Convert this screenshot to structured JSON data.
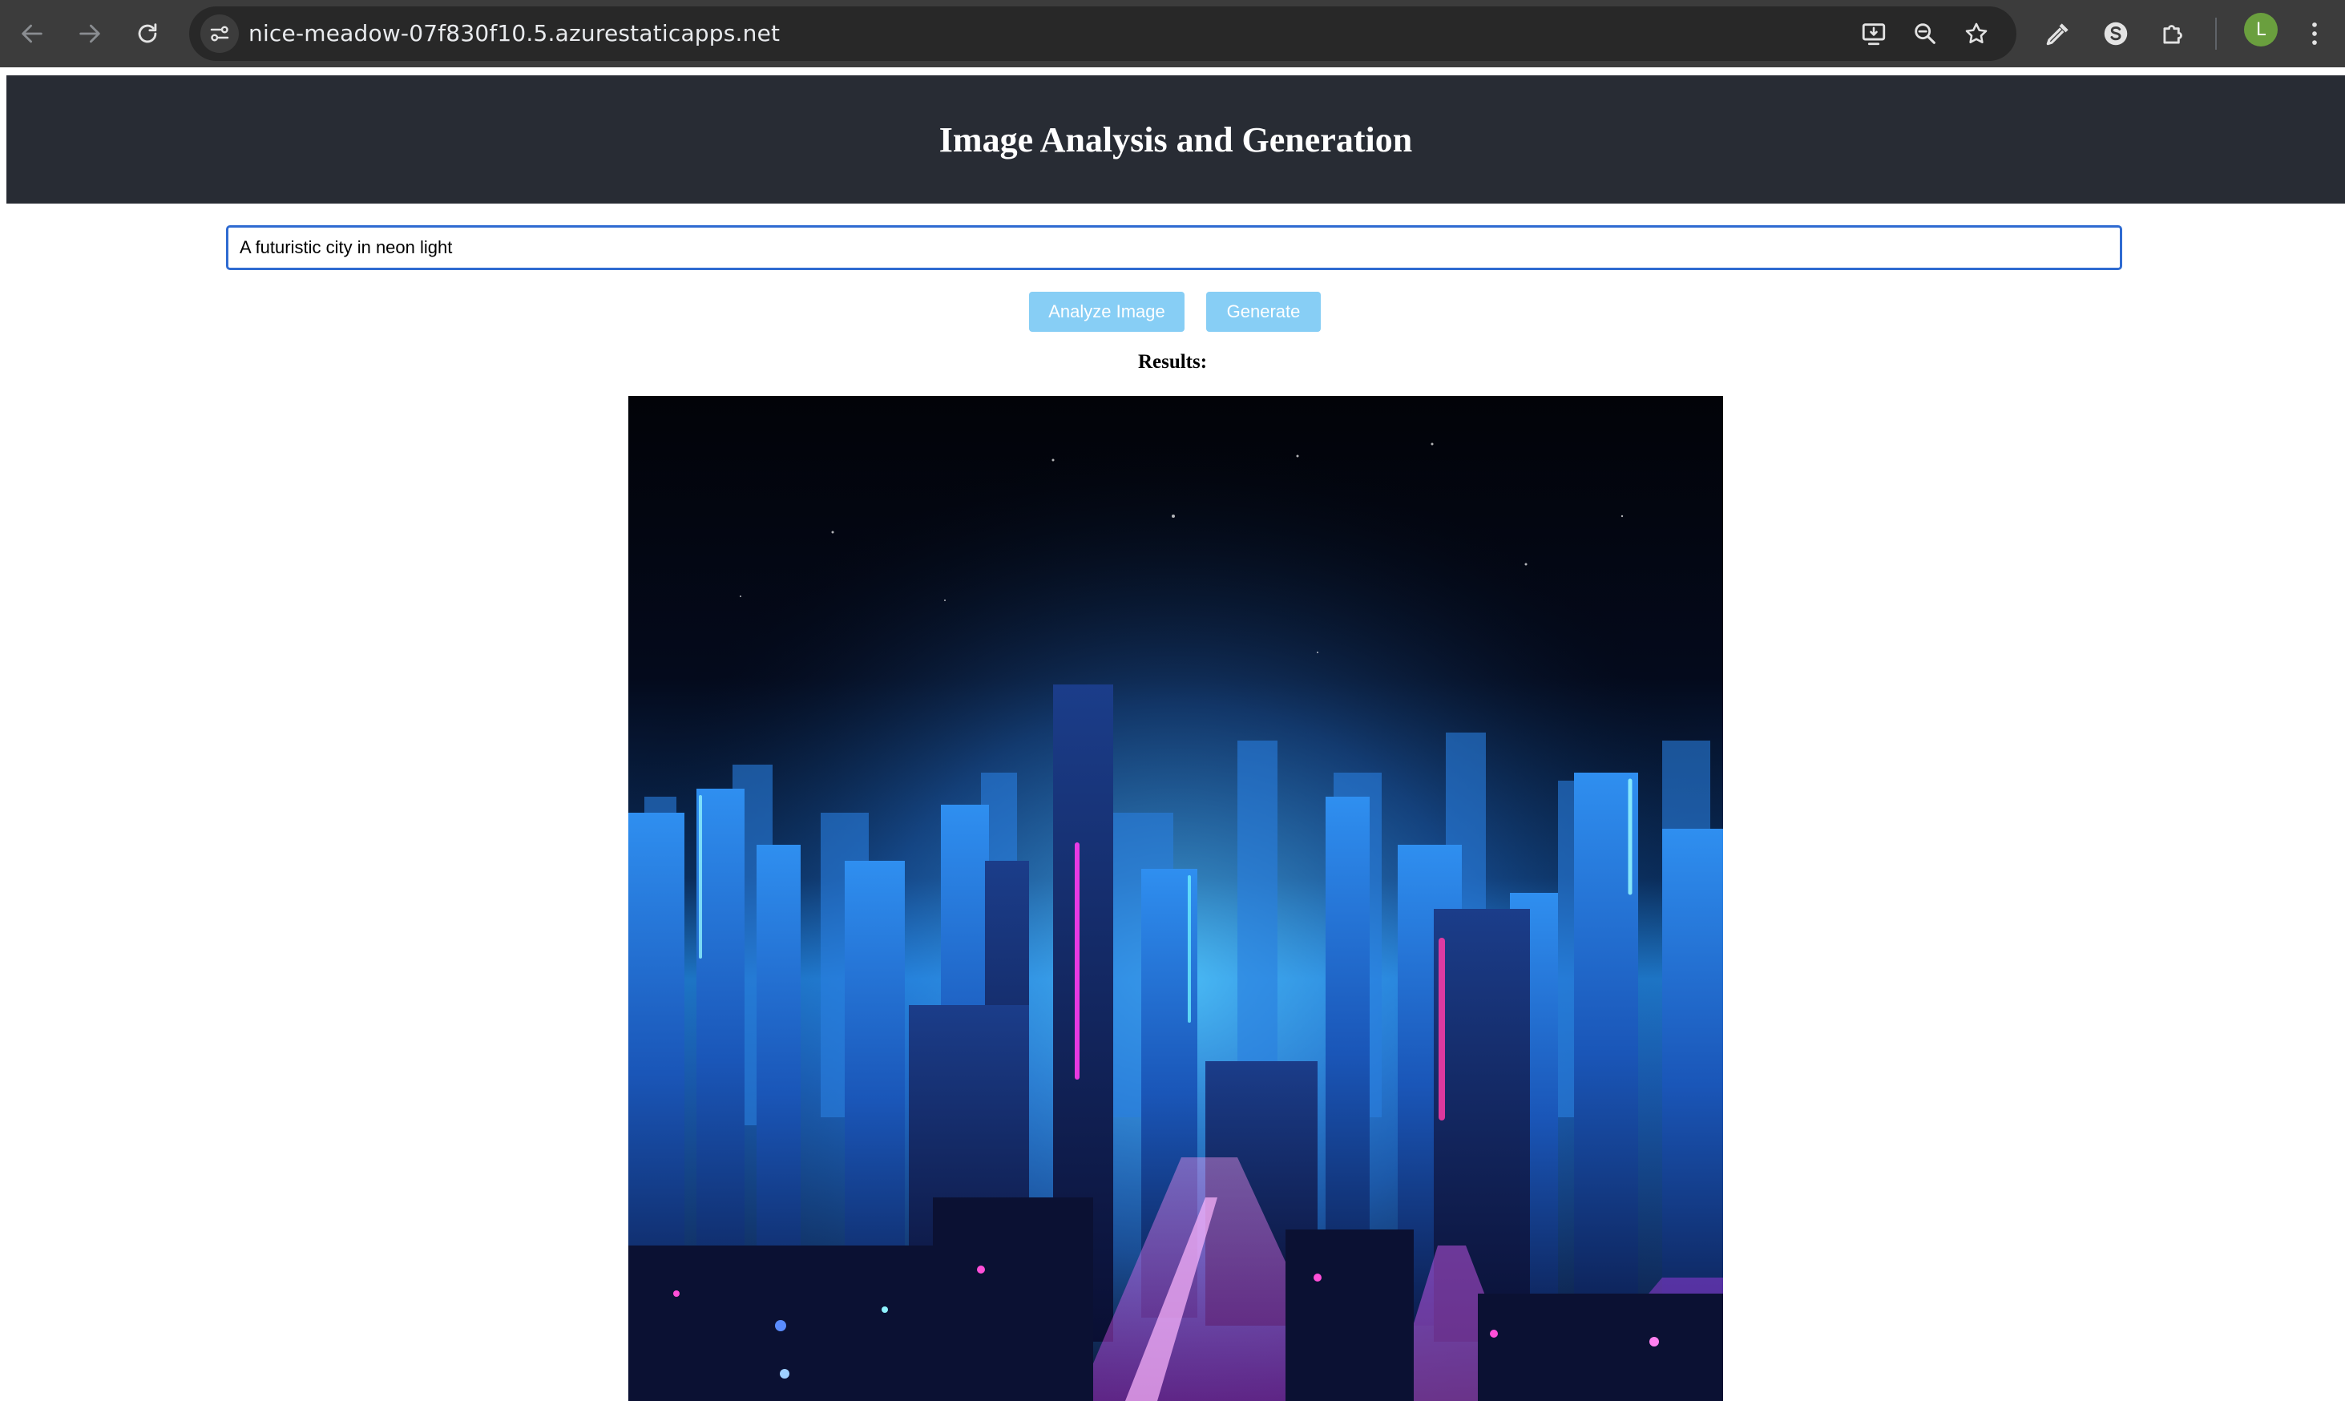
{
  "browser": {
    "url": "nice-meadow-07f830f10.5.azurestaticapps.net",
    "profile_initial": "L",
    "icons": {
      "back": "back-arrow-icon",
      "forward": "forward-arrow-icon",
      "reload": "reload-icon",
      "site_info": "site-info-icon",
      "install_app": "install-app-icon",
      "zoom": "zoom-icon",
      "bookmark": "bookmark-star-icon",
      "eyedropper": "eyedropper-icon",
      "extension_s": "s-extension-icon",
      "extensions": "puzzle-extensions-icon",
      "menu": "more-vert-icon"
    }
  },
  "page": {
    "title": "Image Analysis and Generation",
    "prompt_value": "A futuristic city in neon light",
    "buttons": {
      "analyze": "Analyze Image",
      "generate": "Generate"
    },
    "results_label": "Results:",
    "result_image": "generated-neon-city-image"
  },
  "colors": {
    "header_bg": "#282c34",
    "button_bg": "#87cef5",
    "input_border": "#2f6bd1"
  }
}
